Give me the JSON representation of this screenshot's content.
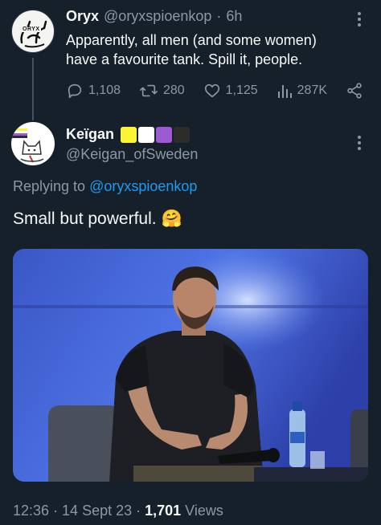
{
  "original_tweet": {
    "author_name": "Oryx",
    "author_handle": "@oryxspioenkop",
    "time": "6h",
    "text_line1": "Apparently, all men (and some women)",
    "text_line2": "have a favourite tank. Spill it, people.",
    "avatar_text": "ORYX",
    "replies": "1,108",
    "retweets": "280",
    "likes": "1,125",
    "views": "287K"
  },
  "reply_tweet": {
    "author_name": "Keïgan",
    "author_handle": "@Keigan_ofSweden",
    "flag_colors": [
      "#fcf434",
      "#ffffff",
      "#9c59d1",
      "#2c2c2c"
    ],
    "replying_prefix": "Replying to",
    "replying_to": "@oryxspioenkop",
    "text": "Small but powerful.",
    "emoji": "🤗",
    "timestamp": "12:36 · 14 Sept 23 · ",
    "views_count": "1,701",
    "views_label": "Views"
  },
  "colors": {
    "background": "#15202b",
    "accent": "#1d9bf0",
    "muted": "#8b98a5"
  }
}
